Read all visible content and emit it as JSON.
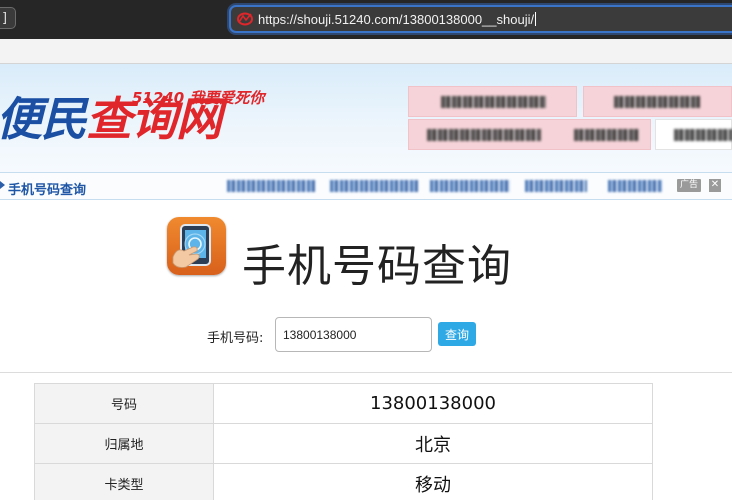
{
  "browser": {
    "url": "https://shouji.51240.com/13800138000__shouji/",
    "back_glyph": "]"
  },
  "site": {
    "logo_part1": "便民",
    "logo_part2": "查询网",
    "tagline": "51240 我要爱死你",
    "colors": {
      "brand_blue": "#1a4fa3",
      "brand_red": "#e0262a",
      "button_blue": "#2fa9e6"
    }
  },
  "nav": {
    "breadcrumb_link": "手机号码查询",
    "ad_badge": "广告",
    "ad_close": "✕"
  },
  "hero": {
    "icon": "phone-touch-icon",
    "title": "手机号码查询"
  },
  "form": {
    "label": "手机号码:",
    "input_value": "13800138000",
    "button_label": "查询"
  },
  "result": {
    "rows": [
      {
        "key": "号码",
        "value": "13800138000"
      },
      {
        "key": "归属地",
        "value": "北京"
      },
      {
        "key": "卡类型",
        "value": "移动"
      }
    ]
  }
}
